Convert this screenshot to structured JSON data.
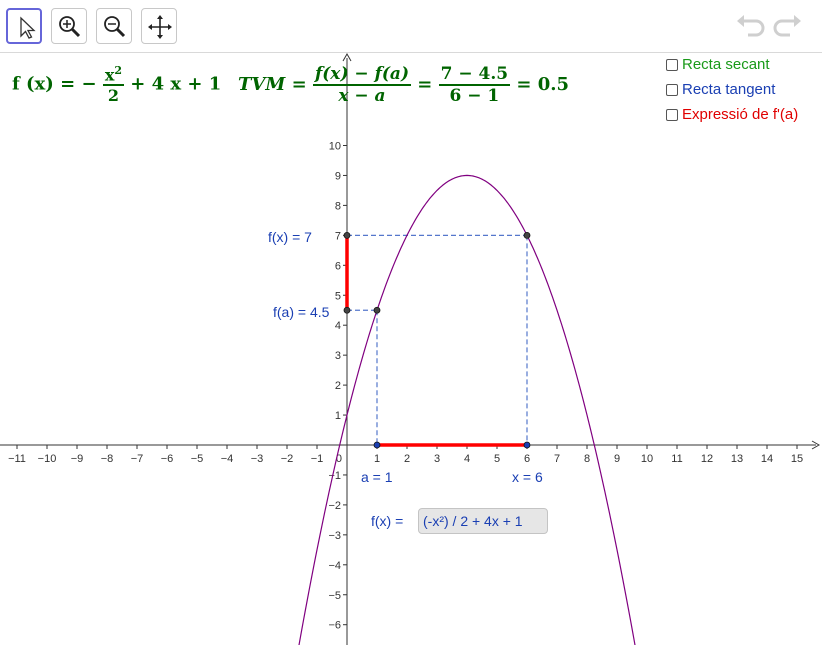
{
  "toolbar": {
    "tools": [
      "move-tool",
      "zoom-in-tool",
      "zoom-out-tool",
      "move-graphics-view-tool"
    ]
  },
  "formula_f": {
    "name": "f (x)",
    "eq": "=",
    "minus": "−",
    "num": "x",
    "sup": "2",
    "den": "2",
    "rest": "+ 4 x + 1"
  },
  "formula_tvm": {
    "lhs": "TVM",
    "eq1": "=",
    "num1": "f(x) − f(a)",
    "den1": "x − a",
    "eq2": "=",
    "num2": "7 − 4.5",
    "den2": "6 − 1",
    "eq3": "= 0.5"
  },
  "checkboxes": [
    {
      "label": "Recta secant",
      "color": "#1a9a1a",
      "checked": false
    },
    {
      "label": "Recta tangent",
      "color": "#1a3fb3",
      "checked": false
    },
    {
      "label": "Expressió de f'(a)",
      "color": "#e00000",
      "checked": false
    }
  ],
  "labels": {
    "fx": "f(x) = 7",
    "fa": "f(a) = 4.5",
    "a": "a = 1",
    "x": "x = 6",
    "input_label": "f(x) ="
  },
  "input": {
    "value": "(-x²) / 2 + 4x + 1"
  },
  "chart_data": {
    "type": "line",
    "xlim": [
      -11.5,
      16
    ],
    "ylim": [
      -6.5,
      11
    ],
    "x_ticks": [
      -11,
      -10,
      -9,
      -8,
      -7,
      -6,
      -5,
      -4,
      -3,
      -2,
      -1,
      0,
      1,
      2,
      3,
      4,
      5,
      6,
      7,
      8,
      9,
      10,
      11,
      12,
      13,
      14,
      15
    ],
    "y_ticks": [
      -6,
      -5,
      -4,
      -3,
      -2,
      -1,
      1,
      2,
      3,
      4,
      5,
      6,
      7,
      8,
      9,
      10
    ],
    "function": "(-x^2)/2 + 4x + 1",
    "points": [
      {
        "x": 1,
        "y": 4.5
      },
      {
        "x": 6,
        "y": 7
      },
      {
        "x": 0,
        "y": 7
      },
      {
        "x": 0,
        "y": 4.5
      },
      {
        "x": 1,
        "y": 0
      },
      {
        "x": 6,
        "y": 0
      }
    ],
    "colors": {
      "curve": "#800080",
      "segment": "#ff0000",
      "dashed": "#5577cc",
      "label": "#1a3fb3"
    }
  }
}
